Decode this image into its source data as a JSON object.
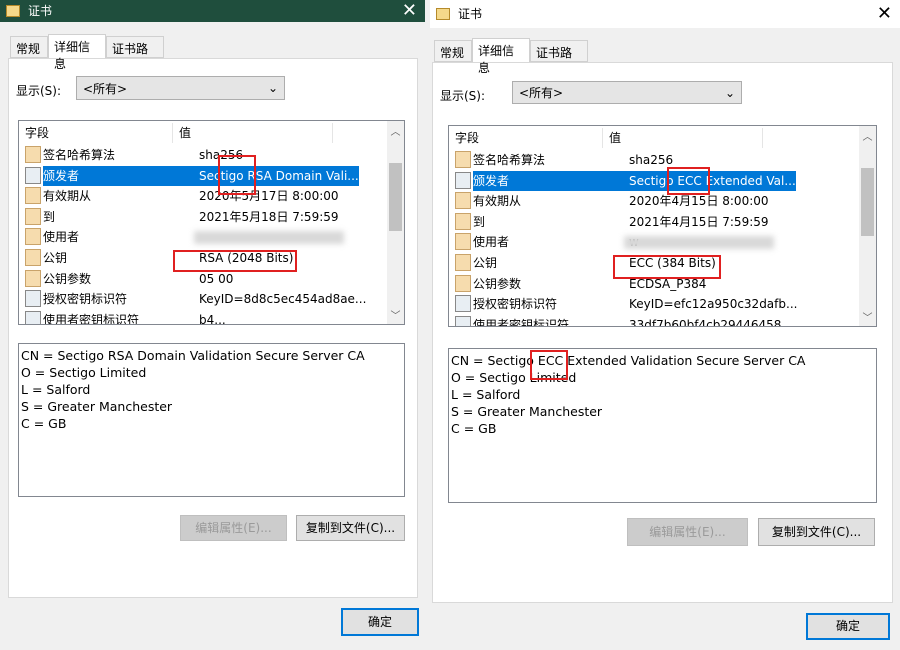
{
  "dialogs": [
    {
      "title": "证书",
      "tabs": [
        "常规",
        "详细信息",
        "证书路径"
      ],
      "active_tab": 1,
      "show_label": "显示(S):",
      "show_value": "<所有>",
      "columns": [
        "字段",
        "值"
      ],
      "rows": [
        {
          "field": "签名哈希算法",
          "value": "sha256"
        },
        {
          "field": "颁发者",
          "value": "Sectigo RSA Domain Vali...",
          "selected": true
        },
        {
          "field": "有效期从",
          "value": "2020年5月17日 8:00:00"
        },
        {
          "field": "到",
          "value": "2021年5月18日 7:59:59"
        },
        {
          "field": "使用者",
          "value": "",
          "blurred": true
        },
        {
          "field": "公钥",
          "value": "RSA (2048 Bits)"
        },
        {
          "field": "公钥参数",
          "value": "05 00"
        },
        {
          "field": "授权密钥标识符",
          "value": "KeyID=8d8c5ec454ad8ae...",
          "icon": "key-id"
        },
        {
          "field": "使用者密钥标识符",
          "value": "b4...",
          "icon": "key-id"
        }
      ],
      "details": [
        "CN = Sectigo RSA Domain Validation Secure Server CA",
        "O = Sectigo Limited",
        "L = Salford",
        "S = Greater Manchester",
        "C = GB"
      ],
      "edit_button": "编辑属性(E)...",
      "copy_button": "复制到文件(C)...",
      "ok_button": "确定",
      "title_bar_color": "#1f4e3d"
    },
    {
      "title": "证书",
      "tabs": [
        "常规",
        "详细信息",
        "证书路径"
      ],
      "active_tab": 1,
      "show_label": "显示(S):",
      "show_value": "<所有>",
      "columns": [
        "字段",
        "值"
      ],
      "rows": [
        {
          "field": "签名哈希算法",
          "value": "sha256"
        },
        {
          "field": "颁发者",
          "value": "Sectigo ECC Extended Val...",
          "selected": true
        },
        {
          "field": "有效期从",
          "value": "2020年4月15日 8:00:00"
        },
        {
          "field": "到",
          "value": "2021年4月15日 7:59:59"
        },
        {
          "field": "使用者",
          "value": "w",
          "blurred": true
        },
        {
          "field": "公钥",
          "value": "ECC (384 Bits)"
        },
        {
          "field": "公钥参数",
          "value": "ECDSA_P384"
        },
        {
          "field": "授权密钥标识符",
          "value": "KeyID=efc12a950c32dafb...",
          "icon": "key-id"
        },
        {
          "field": "使用者密钥标识符",
          "value": "33df7b60bf4cb29446458",
          "icon": "key-id"
        }
      ],
      "details": [
        "CN = Sectigo ECC Extended Validation Secure Server CA",
        "O = Sectigo Limited",
        "L = Salford",
        "S = Greater Manchester",
        "C = GB"
      ],
      "edit_button": "编辑属性(E)...",
      "copy_button": "复制到文件(C)...",
      "ok_button": "确定",
      "title_bar_color": "#ffffff"
    }
  ],
  "highlight_color": "#e02020"
}
